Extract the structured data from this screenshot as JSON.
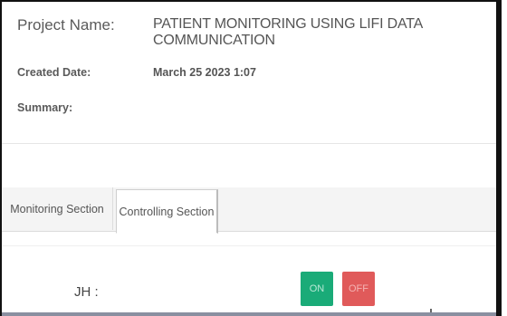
{
  "project": {
    "name_label": "Project Name:",
    "name_value": "PATIENT MONITORING USING LIFI DATA COMMUNICATION",
    "created_label": "Created Date:",
    "created_value": "March 25 2023 1:07",
    "summary_label": "Summary:"
  },
  "tabs": [
    {
      "label": "Monitoring Section",
      "active": false
    },
    {
      "label": "Controlling Section",
      "active": true
    }
  ],
  "control": {
    "device_label": "JH :",
    "on_label": "ON",
    "off_label": "OFF"
  },
  "colors": {
    "on_button": "#1aab78",
    "off_button": "#e05a5a"
  }
}
